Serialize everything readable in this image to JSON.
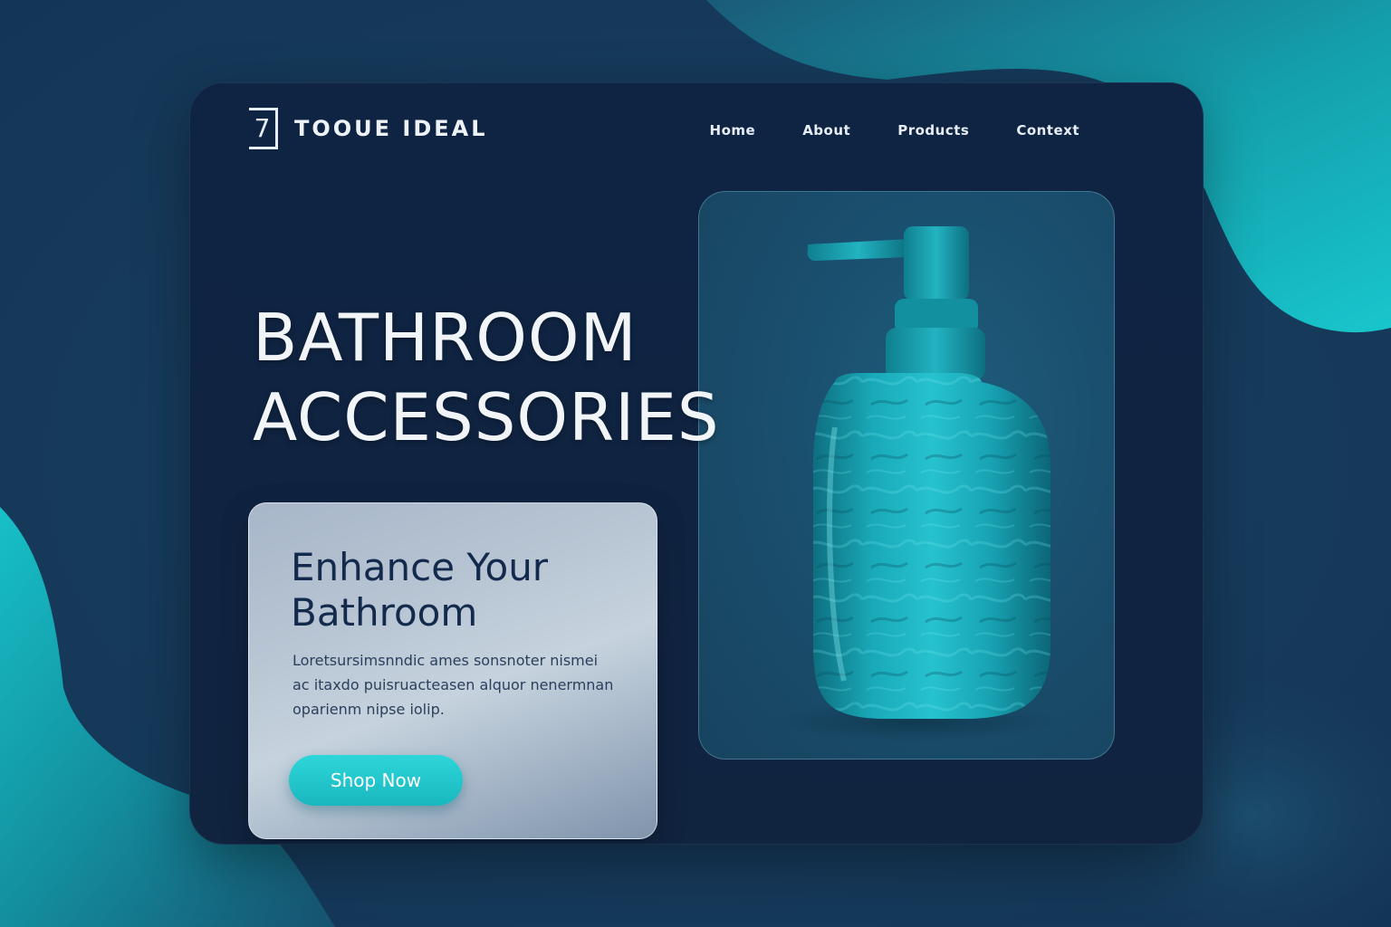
{
  "brand": {
    "logo_glyph": "7",
    "name": "TOOUE IDEAL"
  },
  "nav": {
    "items": [
      "Home",
      "About",
      "Products",
      "Context"
    ]
  },
  "hero": {
    "title_line1": "BATHROOM",
    "title_line2": "ACCESSORIES"
  },
  "info_card": {
    "heading_line1": "Enhance Your",
    "heading_line2": "Bathroom",
    "body": "Loretsursimsnndic ames sonsnoter nismei ac itaxdo puisruacteasen alquor nenermnan oparienm nipse iolip.",
    "cta_label": "Shop Now"
  },
  "colors": {
    "background": "#173b5c",
    "card": "#0f2443",
    "accent_teal": "#19b7bf",
    "text_light": "#f2f5f8",
    "text_dark": "#132a4d"
  },
  "icons": {
    "product_image": "soap-dispenser-icon"
  }
}
